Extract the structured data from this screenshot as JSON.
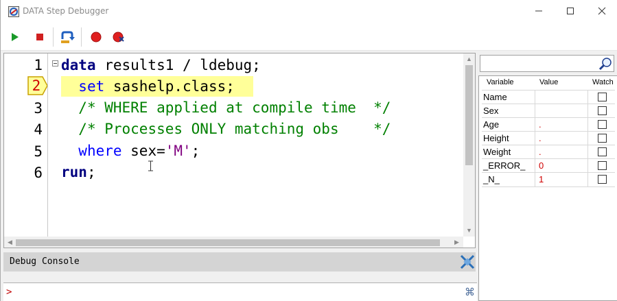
{
  "window": {
    "title": "DATA Step Debugger"
  },
  "toolbar": {
    "go": "go-icon",
    "stop": "stop-icon",
    "step_over": "step-over-icon",
    "breakpoint": "breakpoint-icon",
    "clear_breakpoints": "clear-breakpoints-icon"
  },
  "editor": {
    "line_numbers": [
      "1",
      "2",
      "3",
      "4",
      "5",
      "6"
    ],
    "current_line": "2",
    "lines": {
      "l1": {
        "kw": "data",
        "rest": " results1 / ldebug;"
      },
      "l2": {
        "kw": "set",
        "rest": " sashelp.class;"
      },
      "l3": {
        "comment": "/* WHERE applied at compile time  */"
      },
      "l4": {
        "comment": "/* Processes ONLY matching obs    */"
      },
      "l5": {
        "kw": "where",
        "mid": " sex=",
        "str": "'M'",
        "rest": ";"
      },
      "l6": {
        "kw": "run",
        "rest": ";"
      }
    }
  },
  "console": {
    "title": "Debug Console",
    "prompt": ">"
  },
  "variables": {
    "columns": {
      "variable": "Variable",
      "value": "Value",
      "watch": "Watch"
    },
    "rows": [
      {
        "name": "Name",
        "value": ""
      },
      {
        "name": "Sex",
        "value": ""
      },
      {
        "name": "Age",
        "value": "."
      },
      {
        "name": "Height",
        "value": "."
      },
      {
        "name": "Weight",
        "value": "."
      },
      {
        "name": "_ERROR_",
        "value": "0"
      },
      {
        "name": "_N_",
        "value": "1"
      }
    ]
  },
  "colors": {
    "keyword": "#0000ff",
    "keyword_bold": "#000080",
    "comment": "#008000",
    "string": "#800080",
    "current_line_highlight": "#ffff99",
    "value_text": "#d00000"
  }
}
